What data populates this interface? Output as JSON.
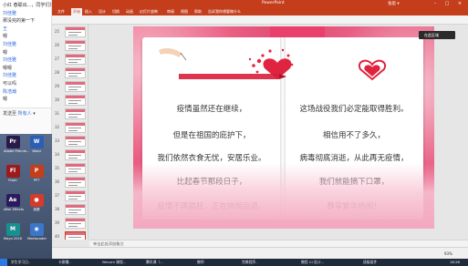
{
  "chat": {
    "lines": [
      {
        "text": "小红 春联出...，同学们好好",
        "kind": "msg"
      },
      {
        "text": "刘佳雅",
        "kind": "name"
      },
      {
        "text": "那没完的第一下",
        "kind": "msg"
      },
      {
        "text": "王",
        "kind": "name"
      },
      {
        "text": "嗯",
        "kind": "msg"
      },
      {
        "text": "刘佳雅",
        "kind": "name"
      },
      {
        "text": "嗯",
        "kind": "msg"
      },
      {
        "text": "刘佳雅",
        "kind": "name"
      },
      {
        "text": "嗯嗯",
        "kind": "msg"
      },
      {
        "text": "刘佳雅",
        "kind": "name"
      },
      {
        "text": "可以吗",
        "kind": "msg"
      },
      {
        "text": "陈浩瀚",
        "kind": "name"
      },
      {
        "text": "嗯",
        "kind": "msg"
      }
    ],
    "input_prefix": "发送至",
    "input_mention": "所有人",
    "input_caret": "▾"
  },
  "desktop": {
    "icons": [
      {
        "label": "Adobe Premie...",
        "glyph": "Pr",
        "color": "#2a1a4a"
      },
      {
        "label": "Word",
        "glyph": "W",
        "color": "#2b5fb4"
      },
      {
        "label": "Flash",
        "glyph": "Fl",
        "color": "#9b1c1c"
      },
      {
        "label": "PPT",
        "glyph": "P",
        "color": "#c43e1c"
      },
      {
        "label": "After Effects",
        "glyph": "Ae",
        "color": "#2c1a5e"
      },
      {
        "label": "录屏",
        "glyph": "●",
        "color": "#d33b2c"
      },
      {
        "label": "Maya 2016",
        "glyph": "M",
        "color": "#1a8f8f"
      },
      {
        "label": "Mediacoder",
        "glyph": "◉",
        "color": "#3a76c9"
      }
    ]
  },
  "ppt": {
    "title": "PowerPoint",
    "user": "张思 ▾",
    "tabs": [
      "文件",
      "开始",
      "插入",
      "设计",
      "切换",
      "动画",
      "幻灯片放映",
      "审阅",
      "视图",
      "帮助",
      "告诉我你想要做什么"
    ],
    "active_tab": "开始",
    "thumbnail_numbers": [
      "25",
      "26",
      "27",
      "28",
      "29",
      "30",
      "31",
      "32",
      "33",
      "34",
      "35",
      "36",
      "37",
      "38",
      "39",
      "40"
    ],
    "active_thumbnail": "40",
    "floating_button": "在此区域",
    "notes_placeholder": "单击此处添加备注",
    "zoom": "93%"
  },
  "slide": {
    "left_lines": [
      "疫情虽然还在继续，",
      "但是在祖国的庇护下，",
      "我们依然衣食无忧，安居乐业。",
      "比起春节那段日子，",
      "疫情不再猖狂，正在悄悄后退。"
    ],
    "right_lines": [
      "这场战役我们必定能取得胜利。",
      "相信用不了多久，",
      "病毒彻底消逝，从此再无疫情，",
      "我们就能摘下口罩，",
      "静享繁华热闹！"
    ],
    "colors": {
      "background": "#e8406b",
      "heart": "#e0243f",
      "page": "#ffffff"
    }
  },
  "taskbar": {
    "items": [
      "学生学习日..",
      "卡歌播..",
      "Wecom 课程...",
      "腾讯课（...",
      "教师",
      "完美程序..",
      "教程 UI 设计...",
      "班级组件"
    ],
    "time": "18:26"
  }
}
